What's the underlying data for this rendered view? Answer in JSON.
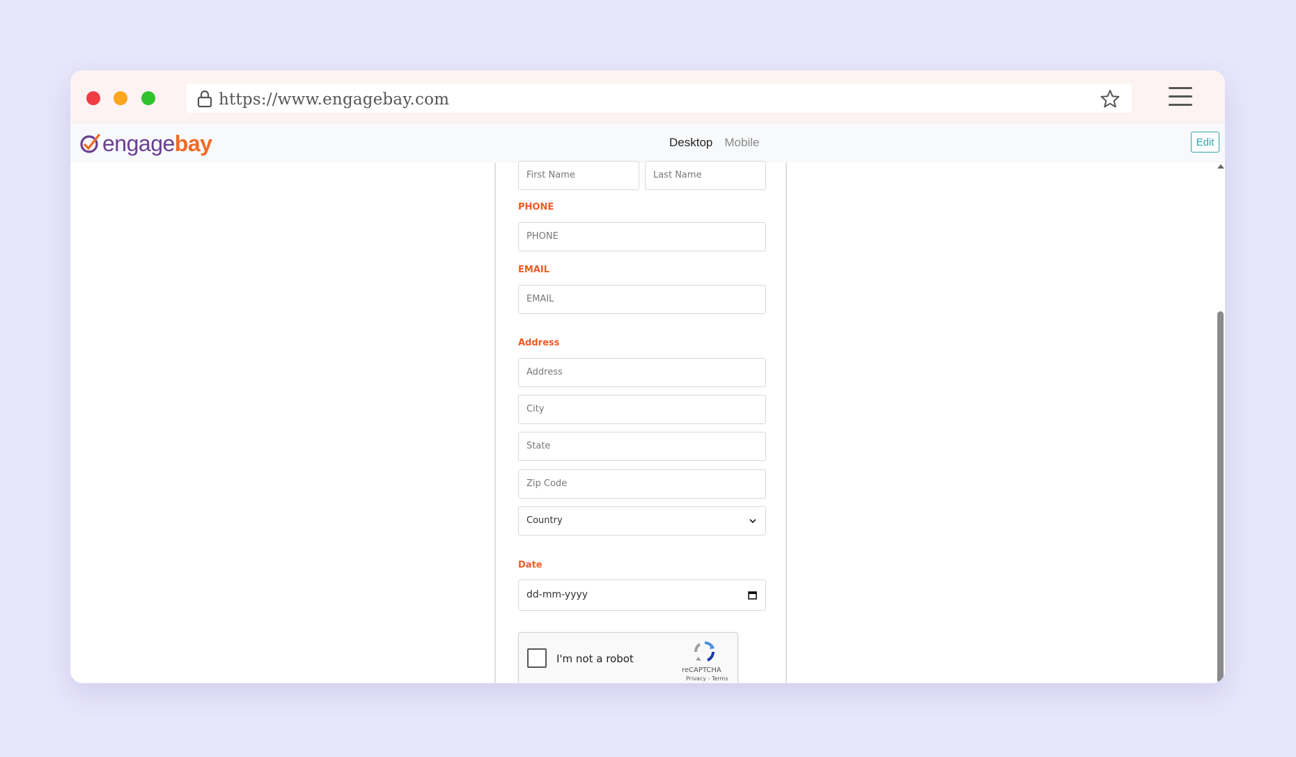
{
  "browser": {
    "url": "https://www.engagebay.com"
  },
  "app": {
    "logo_engage": "engage",
    "logo_bay": "bay",
    "view_desktop": "Desktop",
    "view_mobile": "Mobile",
    "edit_label": "Edit",
    "active_view": "Desktop"
  },
  "form": {
    "first_name_placeholder": "First Name",
    "last_name_placeholder": "Last Name",
    "phone_label": "PHONE",
    "phone_placeholder": "PHONE",
    "email_label": "EMAIL",
    "email_placeholder": "EMAIL",
    "address_label": "Address",
    "address_placeholder": "Address",
    "city_placeholder": "City",
    "state_placeholder": "State",
    "zip_placeholder": "Zip Code",
    "country_value": "Country",
    "date_label": "Date",
    "date_placeholder": "dd-mm-yyyy"
  },
  "captcha": {
    "label": "I'm not a robot",
    "brand": "reCAPTCHA",
    "links": "Privacy - Terms",
    "checked": false
  },
  "colors": {
    "accent": "#f05a24",
    "edit_border": "#2ba3a7",
    "logo_purple": "#6a3f8f",
    "logo_orange": "#f26a26"
  },
  "icons": {
    "lock": "lock-icon",
    "star": "star-icon",
    "menu": "hamburger-menu-icon",
    "country": "chevron-down-icon",
    "date": "calendar-icon",
    "captcha": "recaptcha-icon"
  },
  "scrollbar": {
    "position_fraction": 0.29,
    "visible_fraction": 0.71
  }
}
